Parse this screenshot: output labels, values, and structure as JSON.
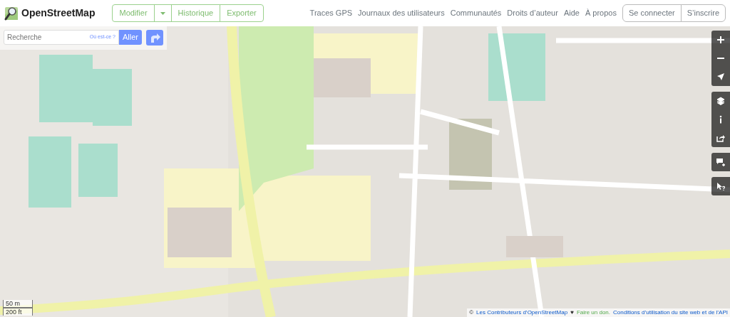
{
  "header": {
    "brand": "OpenStreetMap",
    "edit_group": [
      {
        "kind": "button",
        "label": "Modifier"
      },
      {
        "kind": "caret"
      },
      {
        "kind": "button",
        "label": "Historique"
      },
      {
        "kind": "button",
        "label": "Exporter"
      }
    ],
    "nav_links": [
      "Traces GPS",
      "Journaux des utilisateurs",
      "Communautés",
      "Droits d’auteur",
      "Aide",
      "À propos"
    ],
    "account_buttons": [
      "Se connecter",
      "S’inscrire"
    ]
  },
  "search": {
    "placeholder": "Recherche",
    "where_link": "Où est-ce ?",
    "submit": "Aller"
  },
  "map_controls": [
    [
      {
        "kind": "zoom-in"
      },
      {
        "kind": "zoom-out"
      },
      {
        "kind": "locate"
      }
    ],
    [
      {
        "kind": "layers"
      },
      {
        "kind": "info"
      },
      {
        "kind": "share"
      }
    ],
    [
      {
        "kind": "note"
      }
    ],
    [
      {
        "kind": "query"
      }
    ]
  ],
  "scale": [
    "50 m",
    "200 ft"
  ],
  "attribution": [
    {
      "kind": "text",
      "text": "©"
    },
    {
      "kind": "link",
      "text": "Les Contributeurs d’OpenStreetMap"
    },
    {
      "kind": "text",
      "text": "♥"
    },
    {
      "kind": "donate",
      "text": "Faire un don."
    },
    {
      "kind": "link",
      "text": "Conditions d’utilisation du site web et de l’API"
    }
  ]
}
